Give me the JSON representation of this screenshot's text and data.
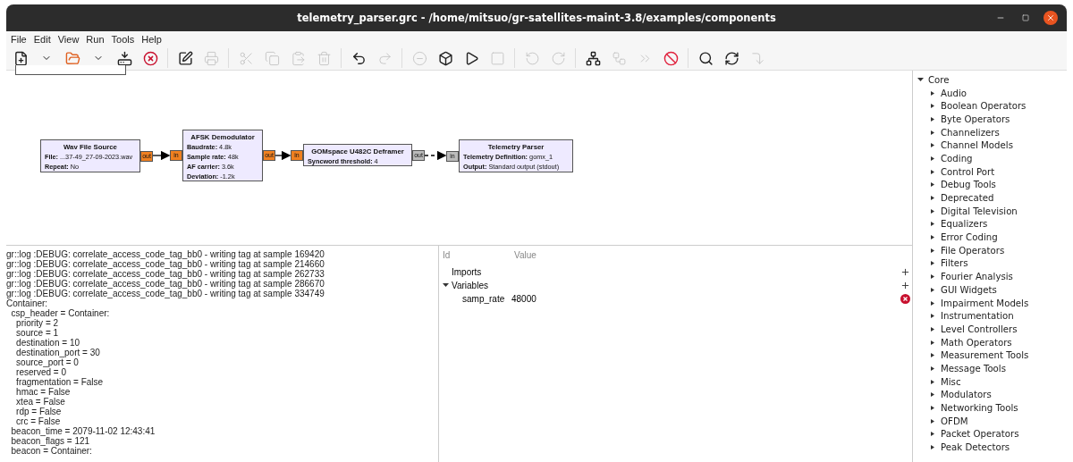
{
  "window": {
    "title": "telemetry_parser.grc - /home/mitsuo/gr-satellites-maint-3.8/examples/components"
  },
  "menu": [
    "File",
    "Edit",
    "View",
    "Run",
    "Tools",
    "Help"
  ],
  "toolbar": [
    {
      "disabled": false
    },
    {
      "disabled": false
    },
    {
      "disabled": false
    },
    {
      "disabled": false
    },
    {
      "disabled": false
    },
    {
      "disabled": false
    },
    {
      "disabled": false
    },
    {
      "disabled": true
    },
    {
      "disabled": true
    },
    {
      "disabled": true
    },
    {
      "disabled": true
    },
    {
      "disabled": true
    },
    {
      "disabled": false
    },
    {
      "disabled": true
    },
    {
      "disabled": true
    },
    {
      "disabled": false
    },
    {
      "disabled": false
    },
    {
      "disabled": true
    },
    {
      "disabled": true
    },
    {
      "disabled": true
    },
    {
      "disabled": false
    },
    {
      "disabled": true
    },
    {
      "disabled": true
    },
    {
      "disabled": false
    },
    {
      "disabled": false
    },
    {
      "disabled": false
    },
    {
      "disabled": true
    }
  ],
  "blocks": [
    {
      "title": "Wav File Source",
      "params": [
        {
          "name": "File:",
          "value": "...37-49_27-09-2023.wav"
        },
        {
          "name": "Repeat:",
          "value": "No"
        }
      ],
      "out_port": {
        "label": "out",
        "kind": "stream"
      }
    },
    {
      "title": "AFSK Demodulator",
      "params": [
        {
          "name": "Baudrate:",
          "value": "4.8k"
        },
        {
          "name": "Sample rate:",
          "value": "48k"
        },
        {
          "name": "AF carrier:",
          "value": "3.6k"
        },
        {
          "name": "Deviation:",
          "value": "-1.2k"
        }
      ],
      "in_port": {
        "label": "in",
        "kind": "stream"
      },
      "out_port": {
        "label": "out",
        "kind": "stream"
      }
    },
    {
      "title": "GOMspace U482C Deframer",
      "params": [
        {
          "name": "Syncword threshold:",
          "value": "4"
        }
      ],
      "in_port": {
        "label": "in",
        "kind": "stream"
      },
      "out_port": {
        "label": "out",
        "kind": "message"
      }
    },
    {
      "title": "Telemetry Parser",
      "params": [
        {
          "name": "Telemetry Definition:",
          "value": "gomx_1"
        },
        {
          "name": "Output:",
          "value": "Standard output (stdout)"
        }
      ],
      "in_port": {
        "label": "in",
        "kind": "message"
      }
    }
  ],
  "connections": [
    {
      "kind": "stream"
    },
    {
      "kind": "stream"
    },
    {
      "kind": "message"
    }
  ],
  "console": [
    "gr::log :DEBUG: correlate_access_code_tag_bb0 - writing tag at sample 169420",
    "gr::log :DEBUG: correlate_access_code_tag_bb0 - writing tag at sample 214660",
    "gr::log :DEBUG: correlate_access_code_tag_bb0 - writing tag at sample 262733",
    "gr::log :DEBUG: correlate_access_code_tag_bb0 - writing tag at sample 286670",
    "gr::log :DEBUG: correlate_access_code_tag_bb0 - writing tag at sample 334749",
    "Container:",
    "  csp_header = Container:",
    "    priority = 2",
    "    source = 1",
    "    destination = 10",
    "    destination_port = 30",
    "    source_port = 0",
    "    reserved = 0",
    "    fragmentation = False",
    "    hmac = False",
    "    xtea = False",
    "    rdp = False",
    "    crc = False",
    "  beacon_time = 2079-11-02 12:43:41",
    "  beacon_flags = 121",
    "  beacon = Container:"
  ],
  "variables": {
    "columns": [
      "Id",
      "Value"
    ],
    "rows": [
      {
        "kind": "category",
        "id": "Imports",
        "expanded": false
      },
      {
        "kind": "category",
        "id": "Variables",
        "expanded": true
      },
      {
        "kind": "variable",
        "id": "samp_rate",
        "value": "48000"
      }
    ]
  },
  "library": {
    "label": "Core",
    "expanded": true,
    "children": [
      {
        "label": "Audio",
        "expanded": false
      },
      {
        "label": "Boolean Operators",
        "expanded": false
      },
      {
        "label": "Byte Operators",
        "expanded": false
      },
      {
        "label": "Channelizers",
        "expanded": false
      },
      {
        "label": "Channel Models",
        "expanded": false
      },
      {
        "label": "Coding",
        "expanded": false
      },
      {
        "label": "Control Port",
        "expanded": false
      },
      {
        "label": "Debug Tools",
        "expanded": false
      },
      {
        "label": "Deprecated",
        "expanded": false
      },
      {
        "label": "Digital Television",
        "expanded": false
      },
      {
        "label": "Equalizers",
        "expanded": false
      },
      {
        "label": "Error Coding",
        "expanded": false
      },
      {
        "label": "File Operators",
        "expanded": false
      },
      {
        "label": "Filters",
        "expanded": false
      },
      {
        "label": "Fourier Analysis",
        "expanded": false
      },
      {
        "label": "GUI Widgets",
        "expanded": false
      },
      {
        "label": "Impairment Models",
        "expanded": false
      },
      {
        "label": "Instrumentation",
        "expanded": false
      },
      {
        "label": "Level Controllers",
        "expanded": false
      },
      {
        "label": "Math Operators",
        "expanded": false
      },
      {
        "label": "Measurement Tools",
        "expanded": false
      },
      {
        "label": "Message Tools",
        "expanded": false
      },
      {
        "label": "Misc",
        "expanded": false
      },
      {
        "label": "Modulators",
        "expanded": false
      },
      {
        "label": "Networking Tools",
        "expanded": false
      },
      {
        "label": "OFDM",
        "expanded": false
      },
      {
        "label": "Packet Operators",
        "expanded": false
      },
      {
        "label": "Peak Detectors",
        "expanded": false
      }
    ]
  }
}
